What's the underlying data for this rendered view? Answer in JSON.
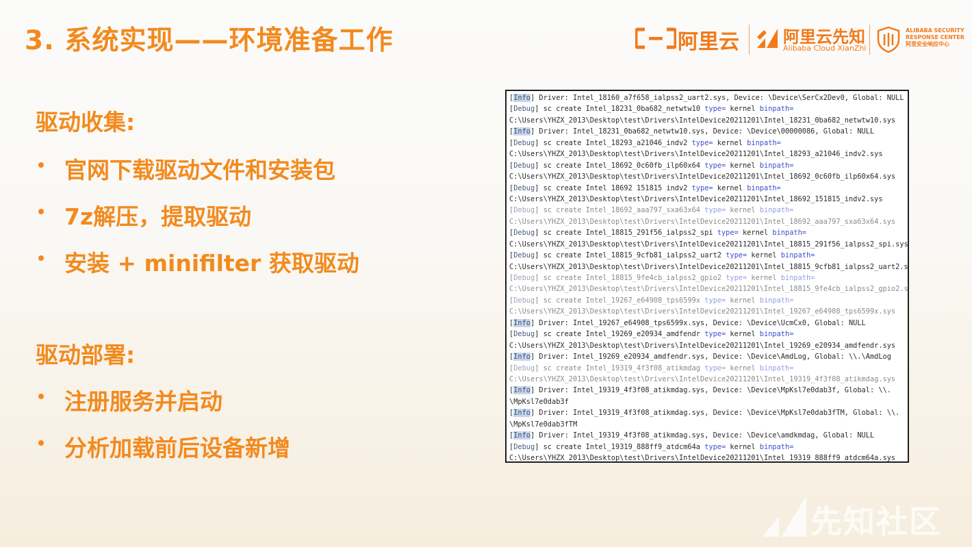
{
  "slide": {
    "title": "3. 系统实现——环境准备工作"
  },
  "logos": {
    "aliyun": "阿里云",
    "xianzhi_cn": "阿里云先知",
    "xianzhi_en": "Alibaba Cloud XianZhi",
    "asrc_line1": "ALIBABA SECURITY",
    "asrc_line2": "RESPONSE CENTER",
    "asrc_line3": "阿里安全响应中心",
    "brand_color": "#f27a1a"
  },
  "sections": [
    {
      "heading": "驱动收集:",
      "bullets": [
        "官网下载驱动文件和安装包",
        "7z解压，提取驱动",
        "安装 + minifilter 获取驱动"
      ]
    },
    {
      "heading": "驱动部署:",
      "bullets": [
        "注册服务并启动",
        "分析加载前后设备新增"
      ]
    }
  ],
  "console": {
    "lines": [
      {
        "tag": "Info",
        "text": " Driver: Intel_18160_a7f658_ialpss2_uart2.sys, Device: \\Device\\SerCx2Dev0, Global: NULL"
      },
      {
        "tag": "Debug",
        "text": " sc create Intel_18231_0ba682_netwtw10 ",
        "kw1": "type=",
        "mid": " kernel ",
        "kw2": "binpath="
      },
      {
        "tag": "",
        "text": "C:\\Users\\YHZX_2013\\Desktop\\test\\Drivers\\IntelDevice20211201\\Intel_18231_0ba682_netwtw10.sys"
      },
      {
        "tag": "Info",
        "text": " Driver: Intel_18231_0ba682_netwtw10.sys, Device: \\Device\\00000086, Global: NULL"
      },
      {
        "tag": "Debug",
        "text": " sc create Intel_18293_a21046_indv2 ",
        "kw1": "type=",
        "mid": " kernel ",
        "kw2": "binpath="
      },
      {
        "tag": "",
        "text": "C:\\Users\\YHZX_2013\\Desktop\\test\\Drivers\\IntelDevice20211201\\Intel_18293_a21046_indv2.sys"
      },
      {
        "tag": "Debug",
        "text": " sc create Intel_18692_0c60fb_ilp60x64 ",
        "kw1": "type=",
        "mid": " kernel ",
        "kw2": "binpath="
      },
      {
        "tag": "",
        "text": "C:\\Users\\YHZX_2013\\Desktop\\test\\Drivers\\IntelDevice20211201\\Intel_18692_0c60fb_ilp60x64.sys"
      },
      {
        "tag": "Debug",
        "text": " sc create Intel 18692 151815 indv2 ",
        "kw1": "type=",
        "mid": " kernel ",
        "kw2": "binpath="
      },
      {
        "tag": "",
        "text": "C:\\Users\\YHZX_2013\\Desktop\\test\\Drivers\\IntelDevice20211201\\Intel_18692_151815_indv2.sys"
      },
      {
        "tag": "Debug",
        "text": " sc create Intel_18692_aaa797_sxa63x64 ",
        "kw1": "type=",
        "mid": " kernel ",
        "kw2": "binpath=",
        "faded": true
      },
      {
        "tag": "",
        "text": "C:\\Users\\YHZX_2013\\Desktop\\test\\Drivers\\IntelDevice20211201\\Intel_18692_aaa797_sxa63x64.sys",
        "faded": true
      },
      {
        "tag": "Debug",
        "text": " sc create Intel_18815_291f56_ialpss2_spi ",
        "kw1": "type=",
        "mid": " kernel ",
        "kw2": "binpath="
      },
      {
        "tag": "",
        "text": "C:\\Users\\YHZX_2013\\Desktop\\test\\Drivers\\IntelDevice20211201\\Intel_18815_291f56_ialpss2_spi.sys"
      },
      {
        "tag": "Debug",
        "text": " sc create Intel_18815_9cfb81_ialpss2_uart2 ",
        "kw1": "type=",
        "mid": " kernel ",
        "kw2": "binpath="
      },
      {
        "tag": "",
        "text": "C:\\Users\\YHZX_2013\\Desktop\\test\\Drivers\\IntelDevice20211201\\Intel_18815_9cfb81_ialpss2_uart2.sys"
      },
      {
        "tag": "Debug",
        "text": " sc create Intel_18815_9fe4cb_ialpss2_gpio2 ",
        "kw1": "type=",
        "mid": " kernel ",
        "kw2": "binpath=",
        "faded": true
      },
      {
        "tag": "",
        "text": "C:\\Users\\YHZX_2013\\Desktop\\test\\Drivers\\IntelDevice20211201\\Intel_18815_9fe4cb_ialpss2_gpio2.sys",
        "faded": true
      },
      {
        "tag": "Debug",
        "text": " sc create Intel_19267_e64908_tps6599x ",
        "kw1": "type=",
        "mid": " kernel ",
        "kw2": "binpath=",
        "faded": true
      },
      {
        "tag": "",
        "text": "C:\\Users\\YHZX_2013\\Desktop\\test\\Drivers\\IntelDevice20211201\\Intel_19267_e64908_tps6599x.sys",
        "faded": true
      },
      {
        "tag": "Info",
        "text": " Driver: Intel_19267_e64908_tps6599x.sys, Device: \\Device\\UcmCx0, Global: NULL"
      },
      {
        "tag": "Debug",
        "text": " sc create Intel_19269_e20934_amdfendr ",
        "kw1": "type=",
        "mid": " kernel ",
        "kw2": "binpath="
      },
      {
        "tag": "",
        "text": "C:\\Users\\YHZX_2013\\Desktop\\test\\Drivers\\IntelDevice20211201\\Intel_19269_e20934_amdfendr.sys"
      },
      {
        "tag": "Info",
        "text": " Driver: Intel_19269_e20934_amdfendr.sys, Device: \\Device\\AmdLog, Global: \\\\.\\AmdLog"
      },
      {
        "tag": "Debug",
        "text": " sc create Intel_19319_4f3f08_atikmdag ",
        "kw1": "type=",
        "mid": " kernel ",
        "kw2": "binpath=",
        "faded": true
      },
      {
        "tag": "",
        "text": "C:\\Users\\YHZX_2013\\Desktop\\test\\Drivers\\IntelDevice20211201\\Intel_19319_4f3f08_atikmdag.sys",
        "faded": true
      },
      {
        "tag": "Info",
        "text": " Driver: Intel_19319_4f3f08_atikmdag.sys, Device: \\Device\\MpKsl7e0dab3f, Global: \\\\."
      },
      {
        "tag": "",
        "text": "\\MpKsl7e0dab3f"
      },
      {
        "tag": "Info",
        "text": " Driver: Intel_19319_4f3f08_atikmdag.sys, Device: \\Device\\MpKsl7e0dab3fTM, Global: \\\\."
      },
      {
        "tag": "",
        "text": "\\MpKsl7e0dab3fTM"
      },
      {
        "tag": "Info",
        "text": " Driver: Intel_19319_4f3f08_atikmdag.sys, Device: \\Device\\amdkmdag, Global: NULL"
      },
      {
        "tag": "Debug",
        "text": " sc create Intel_19319_888ff9_atdcm64a ",
        "kw1": "type=",
        "mid": " kernel ",
        "kw2": "binpath="
      },
      {
        "tag": "",
        "text": "C:\\Users\\YHZX_2013\\Desktop\\test\\Drivers\\IntelDevice20211201\\Intel_19319_888ff9_atdcm64a.sys"
      }
    ]
  },
  "watermark": {
    "text": "先知社区"
  }
}
